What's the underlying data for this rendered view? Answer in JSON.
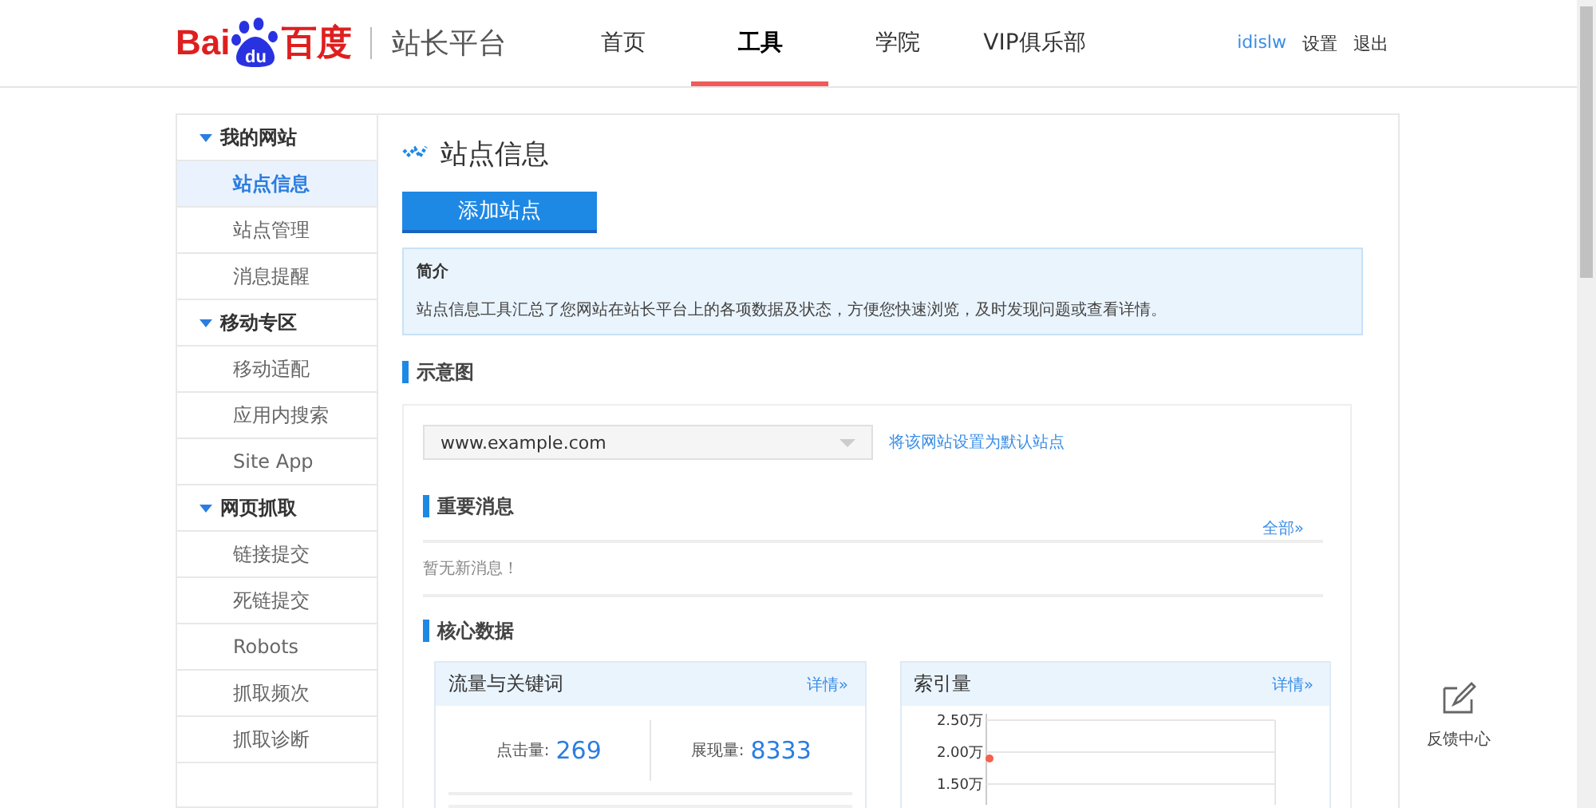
{
  "header": {
    "logo": {
      "left": "Bai",
      "mid": "du",
      "right": "百度"
    },
    "product": "站长平台",
    "nav": [
      {
        "label": "首页",
        "selected": false
      },
      {
        "label": "工具",
        "selected": true
      },
      {
        "label": "学院",
        "selected": false
      },
      {
        "label": "VIP俱乐部",
        "selected": false
      }
    ],
    "user": "idislw",
    "links": [
      "设置",
      "退出"
    ]
  },
  "sidebar": {
    "groups": [
      {
        "label": "我的网站",
        "expanded": true,
        "items": [
          {
            "label": "站点信息",
            "selected": true
          },
          {
            "label": "站点管理",
            "selected": false
          },
          {
            "label": "消息提醒",
            "selected": false
          }
        ]
      },
      {
        "label": "移动专区",
        "expanded": true,
        "items": [
          {
            "label": "移动适配",
            "selected": false
          },
          {
            "label": "应用内搜索",
            "selected": false
          },
          {
            "label": "Site App",
            "selected": false
          }
        ]
      },
      {
        "label": "网页抓取",
        "expanded": true,
        "items": [
          {
            "label": "链接提交",
            "selected": false
          },
          {
            "label": "死链提交",
            "selected": false
          },
          {
            "label": "Robots",
            "selected": false
          },
          {
            "label": "抓取频次",
            "selected": false
          },
          {
            "label": "抓取诊断",
            "selected": false
          }
        ]
      }
    ]
  },
  "main": {
    "title": "站点信息",
    "add_button": "添加站点",
    "intro": {
      "title": "简介",
      "text": "站点信息工具汇总了您网站在站长平台上的各项数据及状态，方便您快速浏览，及时发现问题或查看详情。"
    },
    "section_title": "示意图",
    "site_select": {
      "value": "www.example.com"
    },
    "default_link": "将该网站设置为默认站点",
    "messages": {
      "title": "重要消息",
      "more": "全部»",
      "empty": "暂无新消息！"
    },
    "core": {
      "title": "核心数据",
      "traffic": {
        "title": "流量与关键词",
        "more": "详情»",
        "stats": [
          {
            "label": "点击量:",
            "value": "269"
          },
          {
            "label": "展现量:",
            "value": "8333"
          }
        ]
      },
      "index": {
        "title": "索引量",
        "more": "详情»",
        "y_labels": [
          "2.50万",
          "2.00万",
          "1.50万"
        ]
      }
    }
  },
  "feedback": {
    "label": "反馈中心"
  }
}
